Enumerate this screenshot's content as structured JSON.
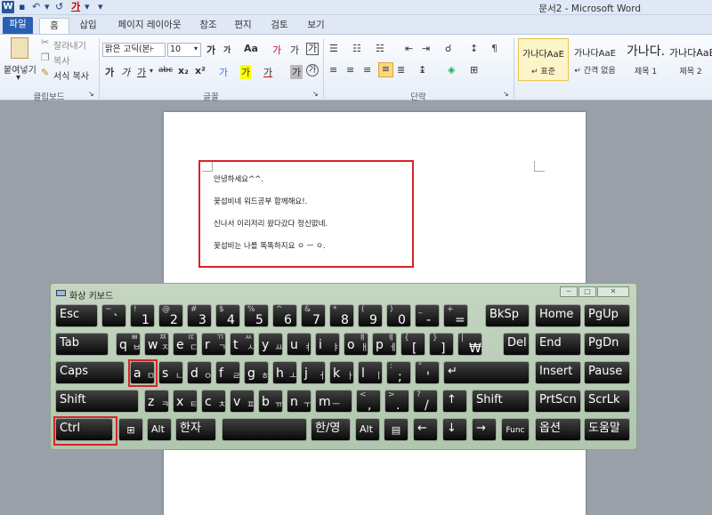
{
  "titlebar": {
    "title": "문서2 - Microsoft Word",
    "app_letter": "W",
    "undo": "↶",
    "redo": "↺",
    "font_color": "가",
    "customize": "▾"
  },
  "tabs": [
    "파일",
    "홈",
    "삽입",
    "페이지 레이아웃",
    "참조",
    "편지",
    "검토",
    "보기"
  ],
  "clipboard": {
    "paste": "붙여넣기",
    "cut": "잘라내기",
    "copy": "복사",
    "format_painter": "서식 복사",
    "group": "클립보드"
  },
  "font": {
    "name": "맑은 고딕(본⊦",
    "size": "10",
    "grow": "가",
    "shrink": "가",
    "case": "Aa",
    "clear": "가",
    "phonetic": "가",
    "charbox": "가",
    "bold": "가",
    "italic": "가",
    "underline": "가",
    "strike": "abc",
    "sub": "x₂",
    "sup": "x²",
    "effects": "가",
    "highlight": "가",
    "fontcolor": "가",
    "shade": "가",
    "enclose": "가",
    "group": "글꼴"
  },
  "paragraph": {
    "group": "단락"
  },
  "styles": [
    {
      "sample": "가나다AaE",
      "name": "↵ 표준"
    },
    {
      "sample": "가나다AaE",
      "name": "↵ 간격 없음"
    },
    {
      "sample": "가나다.",
      "name": "제목 1"
    },
    {
      "sample": "가나다AaE",
      "name": "제목 2"
    }
  ],
  "document": {
    "lines": [
      "안녕하세요^^.",
      "꽃섭비네 워드공부 함께해요!.",
      "신나서 이리저리 왔다갔다 정신없네.",
      "꽃섭비는 나를 똑똑하지요 ㅇ ㅡ ㅇ."
    ],
    "highlight_color": "#d8232a"
  },
  "keyboard": {
    "title": "화상 키보드",
    "minimize": "─",
    "maximize": "□",
    "close": "✕",
    "row1": [
      {
        "l": "~",
        "b": "`"
      },
      {
        "l": "!",
        "b": "1"
      },
      {
        "l": "@",
        "b": "2"
      },
      {
        "l": "#",
        "b": "3"
      },
      {
        "l": "$",
        "b": "4"
      },
      {
        "l": "%",
        "b": "5"
      },
      {
        "l": "^",
        "b": "6"
      },
      {
        "l": "&",
        "b": "7"
      },
      {
        "l": "*",
        "b": "8"
      },
      {
        "l": "(",
        "b": "9"
      },
      {
        "l": ")",
        "b": "0"
      },
      {
        "l": "_",
        "b": "-"
      },
      {
        "l": "+",
        "b": "="
      }
    ],
    "row2": [
      {
        "a": "q",
        "h": "ㅂ",
        "l": "ㅃ"
      },
      {
        "a": "w",
        "h": "ㅈ",
        "l": "ㅉ"
      },
      {
        "a": "e",
        "h": "ㄷ",
        "l": "ㄸ"
      },
      {
        "a": "r",
        "h": "ㄱ",
        "l": "ㄲ"
      },
      {
        "a": "t",
        "h": "ㅅ",
        "l": "ㅆ"
      },
      {
        "a": "y",
        "h": "ㅛ"
      },
      {
        "a": "u",
        "h": "ㅕ"
      },
      {
        "a": "i",
        "h": "ㅑ"
      },
      {
        "a": "o",
        "h": "ㅐ",
        "l": "ㅒ"
      },
      {
        "a": "p",
        "h": "ㅔ",
        "l": "ㅖ"
      },
      {
        "l": "{",
        "b": "["
      },
      {
        "l": "}",
        "b": "]"
      },
      {
        "l": "|",
        "b": "₩"
      }
    ],
    "row3": [
      {
        "a": "a",
        "h": "ㅁ"
      },
      {
        "a": "s",
        "h": "ㄴ"
      },
      {
        "a": "d",
        "h": "ㅇ"
      },
      {
        "a": "f",
        "h": "ㄹ"
      },
      {
        "a": "g",
        "h": "ㅎ"
      },
      {
        "a": "h",
        "h": "ㅗ"
      },
      {
        "a": "j",
        "h": "ㅓ"
      },
      {
        "a": "k",
        "h": "ㅏ"
      },
      {
        "a": "l",
        "h": "ㅣ"
      },
      {
        "l": ":",
        "b": ";"
      },
      {
        "l": "\"",
        "b": "'"
      }
    ],
    "row4": [
      {
        "a": "z",
        "h": "ㅋ"
      },
      {
        "a": "x",
        "h": "ㅌ"
      },
      {
        "a": "c",
        "h": "ㅊ"
      },
      {
        "a": "v",
        "h": "ㅍ"
      },
      {
        "a": "b",
        "h": "ㅠ"
      },
      {
        "a": "n",
        "h": "ㅜ"
      },
      {
        "a": "m",
        "h": "ㅡ"
      },
      {
        "l": "<",
        "b": ","
      },
      {
        "l": ">",
        "b": "."
      },
      {
        "l": "?",
        "b": "/"
      }
    ],
    "keys": {
      "esc": "Esc",
      "bksp": "BkSp",
      "home": "Home",
      "pgup": "PgUp",
      "tab": "Tab",
      "del": "Del",
      "end": "End",
      "pgdn": "PgDn",
      "caps": "Caps",
      "enter": "↵",
      "insert": "Insert",
      "pause": "Pause",
      "shift_l": "Shift",
      "up": "↑",
      "shift_r": "Shift",
      "prtscn": "PrtScn",
      "scrlk": "ScrLk",
      "ctrl": "Ctrl",
      "win": "⊞",
      "alt_l": "Alt",
      "hanja": "한자",
      "space": "",
      "hanyeong": "한/영",
      "alt_r": "Alt",
      "menu": "▤",
      "left": "←",
      "down": "↓",
      "right": "→",
      "fn": "Func",
      "options": "옵션",
      "help": "도움말"
    },
    "highlight_color": "#d8232a"
  }
}
